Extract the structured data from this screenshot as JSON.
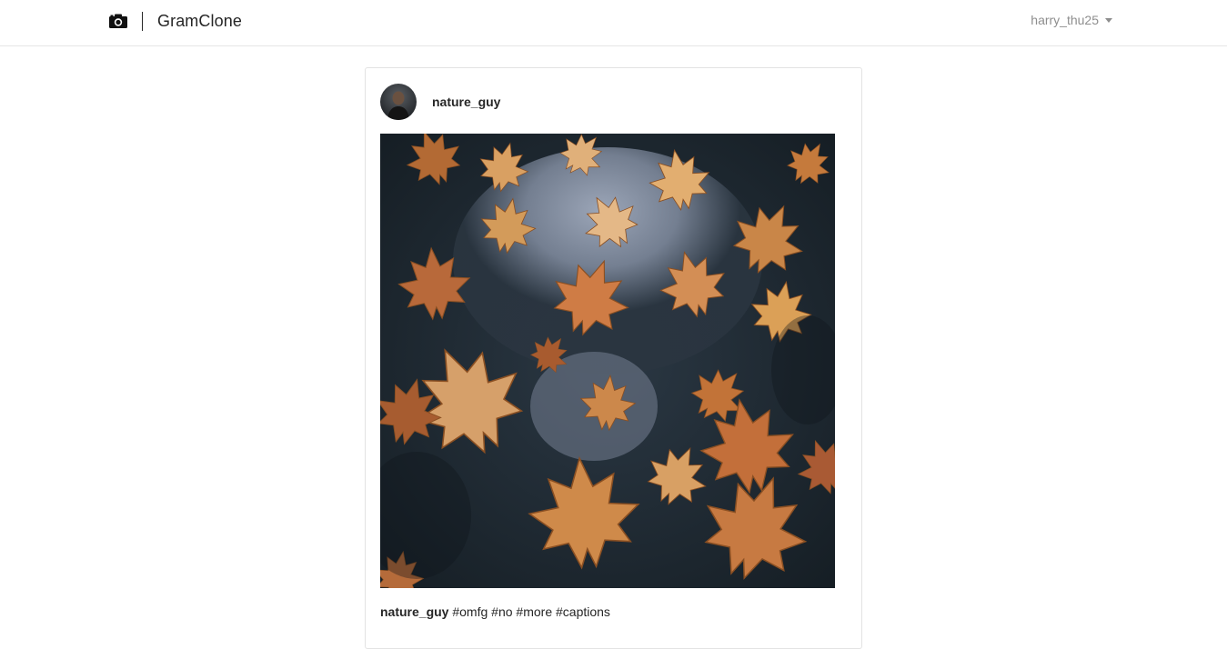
{
  "navbar": {
    "logo_icon": "camera-icon",
    "brand_name": "GramClone",
    "user_menu": {
      "username": "harry_thu25",
      "icon": "caret-down-icon"
    }
  },
  "post": {
    "author": {
      "username": "nature_guy",
      "avatar_icon": "avatar"
    },
    "image": {
      "description_icon": "autumn-leaves-photo"
    },
    "caption": {
      "username": "nature_guy",
      "hashtags": [
        "#omfg",
        "#no",
        "#more",
        "#captions"
      ]
    }
  },
  "colors": {
    "text": "#262626",
    "muted": "#8e8e8e",
    "border": "#e6e6e6",
    "leaf": "#c9803f",
    "water": "#1f2a33"
  }
}
